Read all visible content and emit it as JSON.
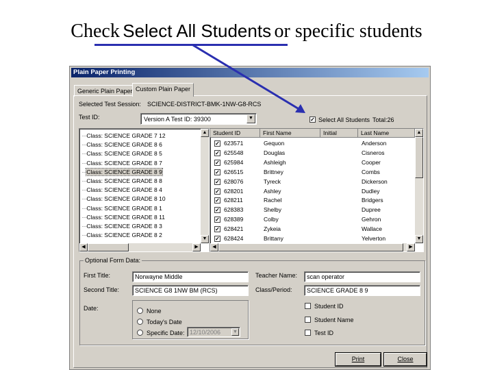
{
  "slide": {
    "title_prefix": "Check",
    "title_highlight": "Select All Students",
    "title_suffix": "or specific students",
    "accent_color": "#2a2fb0"
  },
  "window": {
    "title": "Plain Paper Printing",
    "tabs": [
      {
        "label": "Generic Plain Paper",
        "active": false
      },
      {
        "label": "Custom Plain Paper",
        "active": true
      }
    ],
    "selected_session_label": "Selected Test Session:",
    "selected_session_value": "SCIENCE-DISTRICT-BMK-1NW-G8-RCS",
    "test_id_label": "Test ID:",
    "test_id_value": "Version A Test ID: 39300",
    "select_all_label": "Select All Students",
    "select_all_checked": true,
    "total_label": "Total:26",
    "classes": [
      "Class: SCIENCE GRADE 7 12",
      "Class: SCIENCE GRADE 8 6",
      "Class: SCIENCE GRADE 8 5",
      "Class: SCIENCE GRADE 8 7",
      "Class: SCIENCE GRADE 8 9",
      "Class: SCIENCE GRADE 8 8",
      "Class: SCIENCE GRADE 8 4",
      "Class: SCIENCE GRADE 8 10",
      "Class: SCIENCE GRADE 8 1",
      "Class: SCIENCE GRADE 8 11",
      "Class: SCIENCE GRADE 8 3",
      "Class: SCIENCE GRADE 8 2"
    ],
    "selected_class_index": 4,
    "student_columns": [
      "Student ID",
      "First Name",
      "Initial",
      "Last Name"
    ],
    "students": [
      {
        "id": "623571",
        "first": "Gequon",
        "initial": "",
        "last": "Anderson"
      },
      {
        "id": "625548",
        "first": "Douglas",
        "initial": "",
        "last": "Cisneros"
      },
      {
        "id": "625984",
        "first": "Ashleigh",
        "initial": "",
        "last": "Cooper"
      },
      {
        "id": "626515",
        "first": "Brittney",
        "initial": "",
        "last": "Combs"
      },
      {
        "id": "628076",
        "first": "Tyreck",
        "initial": "",
        "last": "Dickerson"
      },
      {
        "id": "628201",
        "first": "Ashley",
        "initial": "",
        "last": "Dudley"
      },
      {
        "id": "628211",
        "first": "Rachel",
        "initial": "",
        "last": "Bridgers"
      },
      {
        "id": "628383",
        "first": "Shelby",
        "initial": "",
        "last": "Dupree"
      },
      {
        "id": "628389",
        "first": "Colby",
        "initial": "",
        "last": "Gehron"
      },
      {
        "id": "628421",
        "first": "Zykeia",
        "initial": "",
        "last": "Wallace"
      },
      {
        "id": "628424",
        "first": "Brittany",
        "initial": "",
        "last": "Yelverton"
      }
    ],
    "optional_form_data_label": "Optional Form Data:",
    "first_title_label": "First Title:",
    "first_title_value": "Norwayne Middle",
    "second_title_label": "Second Title:",
    "second_title_value": "SCIENCE G8 1NW BM (RCS)",
    "teacher_name_label": "Teacher Name:",
    "teacher_name_value": "scan operator",
    "class_period_label": "Class/Period:",
    "class_period_value": "SCIENCE GRADE 8 9",
    "date_label": "Date:",
    "date_options": [
      "None",
      "Today's Date",
      "Specific Date:"
    ],
    "specific_date_value": "12/10/2006",
    "extra_checkboxes": [
      "Student ID",
      "Student Name",
      "Test ID"
    ],
    "print_label": "Print",
    "close_label": "Close"
  }
}
